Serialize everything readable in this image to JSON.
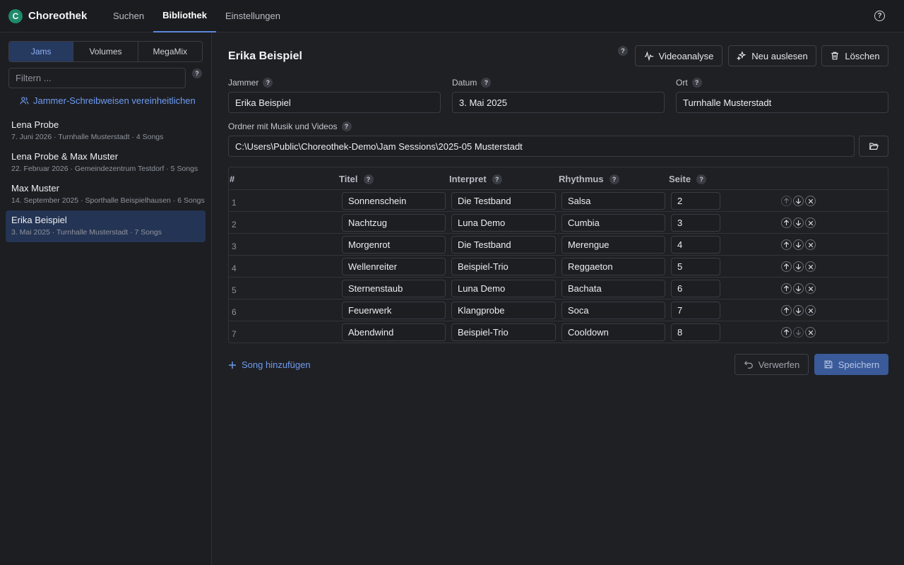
{
  "app": {
    "name": "Choreothek",
    "logo_letter": "C"
  },
  "nav": {
    "tabs": [
      "Suchen",
      "Bibliothek",
      "Einstellungen"
    ],
    "active": "Bibliothek"
  },
  "sidebar": {
    "segments": [
      "Jams",
      "Volumes",
      "MegaMix"
    ],
    "active_segment": "Jams",
    "filter_placeholder": "Filtern ...",
    "unify_label": "Jammer-Schreibweisen vereinheitlichen",
    "jams": [
      {
        "name": "Lena Probe",
        "meta": "7. Juni 2026 · Turnhalle Musterstadt · 4 Songs"
      },
      {
        "name": "Lena Probe & Max Muster",
        "meta": "22. Februar 2026 · Gemeindezentrum Testdorf · 5 Songs"
      },
      {
        "name": "Max Muster",
        "meta": "14. September 2025 · Sporthalle Beispielhausen · 6 Songs"
      },
      {
        "name": "Erika Beispiel",
        "meta": "3. Mai 2025 · Turnhalle Musterstadt · 7 Songs",
        "selected": true
      }
    ]
  },
  "detail": {
    "title": "Erika Beispiel",
    "buttons": {
      "video": "Videoanalyse",
      "reread": "Neu auslesen",
      "delete": "Löschen"
    },
    "fields": {
      "jammer_label": "Jammer",
      "jammer_value": "Erika Beispiel",
      "date_label": "Datum",
      "date_value": "3. Mai 2025",
      "place_label": "Ort",
      "place_value": "Turnhalle Musterstadt",
      "folder_label": "Ordner mit Musik und Videos",
      "folder_value": "C:\\Users\\Public\\Choreothek-Demo\\Jam Sessions\\2025-05 Musterstadt"
    },
    "table": {
      "headers": {
        "num": "#",
        "title": "Titel",
        "artist": "Interpret",
        "rhythm": "Rhythmus",
        "page": "Seite"
      },
      "rows": [
        {
          "num": "1",
          "title": "Sonnenschein",
          "artist": "Die Testband",
          "rhythm": "Salsa",
          "page": "2"
        },
        {
          "num": "2",
          "title": "Nachtzug",
          "artist": "Luna Demo",
          "rhythm": "Cumbia",
          "page": "3"
        },
        {
          "num": "3",
          "title": "Morgenrot",
          "artist": "Die Testband",
          "rhythm": "Merengue",
          "page": "4"
        },
        {
          "num": "4",
          "title": "Wellenreiter",
          "artist": "Beispiel-Trio",
          "rhythm": "Reggaeton",
          "page": "5"
        },
        {
          "num": "5",
          "title": "Sternenstaub",
          "artist": "Luna Demo",
          "rhythm": "Bachata",
          "page": "6"
        },
        {
          "num": "6",
          "title": "Feuerwerk",
          "artist": "Klangprobe",
          "rhythm": "Soca",
          "page": "7"
        },
        {
          "num": "7",
          "title": "Abendwind",
          "artist": "Beispiel-Trio",
          "rhythm": "Cooldown",
          "page": "8"
        }
      ]
    },
    "add_song": "Song hinzufügen",
    "discard": "Verwerfen",
    "save": "Speichern"
  }
}
